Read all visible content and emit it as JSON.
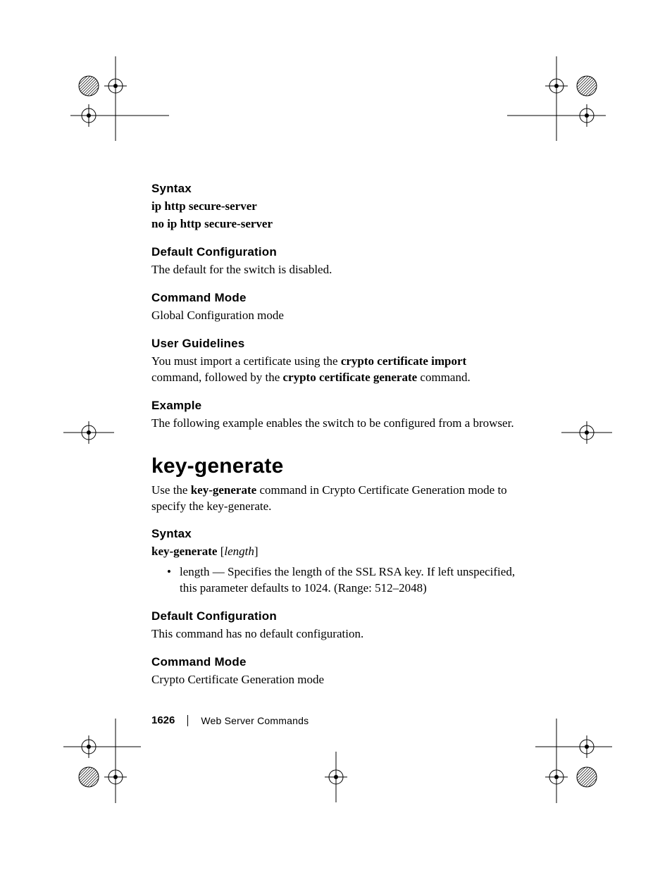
{
  "sections": {
    "syntax1": {
      "head": "Syntax",
      "line1": "ip http secure-server",
      "line2": "no ip http secure-server"
    },
    "defcfg1": {
      "head": "Default Configuration",
      "body": "The default for the switch is disabled."
    },
    "cmdmode1": {
      "head": "Command Mode",
      "body": "Global Configuration mode"
    },
    "userg": {
      "head": "User Guidelines",
      "pre": "You must import a certificate using the ",
      "bold1": "crypto certificate import",
      "mid": " command, followed by the ",
      "bold2": "crypto certificate generate",
      "post": " command."
    },
    "example": {
      "head": "Example",
      "body": "The following example enables the switch to be configured from a browser."
    },
    "cmd_title": "key-generate",
    "cmd_intro_pre": "Use the ",
    "cmd_intro_bold": "key-generate",
    "cmd_intro_post": " command in Crypto Certificate Generation mode to specify the key-generate.",
    "syntax2": {
      "head": "Syntax",
      "line_bold": "key-generate",
      "line_plain1": " [",
      "line_italic": "length",
      "line_plain2": "]"
    },
    "bullet": {
      "term": "length",
      "dash": " — ",
      "rest": "Specifies the length of the SSL RSA key. If left unspecified, this parameter defaults to 1024. (Range: 512–2048)"
    },
    "defcfg2": {
      "head": "Default Configuration",
      "body": "This command has no default configuration."
    },
    "cmdmode2": {
      "head": "Command Mode",
      "body": "Crypto Certificate Generation mode"
    }
  },
  "footer": {
    "page": "1626",
    "section": "Web Server Commands"
  }
}
